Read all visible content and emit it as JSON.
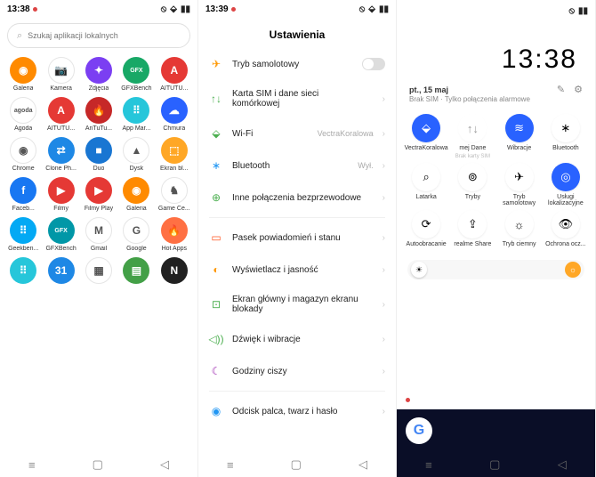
{
  "s1": {
    "time": "13:38",
    "search_placeholder": "Szukaj aplikacji lokalnych",
    "apps": [
      {
        "label": "Galeria",
        "bg": "#ff8a00",
        "txt": "◉"
      },
      {
        "label": "Kamera",
        "bg": "#fff",
        "txt": "📷"
      },
      {
        "label": "Zdjęcia",
        "bg": "#7b3ff2",
        "txt": "✦"
      },
      {
        "label": "GFXBench",
        "bg": "#18a866",
        "txt": "GFX"
      },
      {
        "label": "AITUTU...",
        "bg": "#e53935",
        "txt": "A"
      },
      {
        "label": "Agoda",
        "bg": "#fff",
        "txt": "agoda"
      },
      {
        "label": "AITUTU...",
        "bg": "#e53935",
        "txt": "A"
      },
      {
        "label": "AnTuTu...",
        "bg": "#c62828",
        "txt": "🔥"
      },
      {
        "label": "App Mar...",
        "bg": "#26c6da",
        "txt": "⠿"
      },
      {
        "label": "Chmura",
        "bg": "#2962ff",
        "txt": "☁"
      },
      {
        "label": "Chrome",
        "bg": "#fff",
        "txt": "◉"
      },
      {
        "label": "Clone Ph...",
        "bg": "#1e88e5",
        "txt": "⇄"
      },
      {
        "label": "Duo",
        "bg": "#1976d2",
        "txt": "■"
      },
      {
        "label": "Dysk",
        "bg": "#fff",
        "txt": "▲"
      },
      {
        "label": "Ekran bl...",
        "bg": "#ffa726",
        "txt": "⬚"
      },
      {
        "label": "Faceb...",
        "bg": "#1877f2",
        "txt": "f"
      },
      {
        "label": "Filmy",
        "bg": "#e53935",
        "txt": "▶"
      },
      {
        "label": "Filmy Play",
        "bg": "#e53935",
        "txt": "▶"
      },
      {
        "label": "Galeria",
        "bg": "#ff8a00",
        "txt": "◉"
      },
      {
        "label": "Game Ce...",
        "bg": "#fff",
        "txt": "♞"
      },
      {
        "label": "Geekben...",
        "bg": "#03a9f4",
        "txt": "⠿"
      },
      {
        "label": "GFXBench",
        "bg": "#0097a7",
        "txt": "GFX"
      },
      {
        "label": "Gmail",
        "bg": "#fff",
        "txt": "M"
      },
      {
        "label": "Google",
        "bg": "#fff",
        "txt": "G"
      },
      {
        "label": "Hot Apps",
        "bg": "#ff7043",
        "txt": "🔥"
      },
      {
        "label": "",
        "bg": "#26c6da",
        "txt": "⠿"
      },
      {
        "label": "",
        "bg": "#1e88e5",
        "txt": "31"
      },
      {
        "label": "",
        "bg": "#fff",
        "txt": "▦"
      },
      {
        "label": "",
        "bg": "#43a047",
        "txt": "▤"
      },
      {
        "label": "",
        "bg": "#212121",
        "txt": "N"
      }
    ]
  },
  "s2": {
    "time": "13:39",
    "title": "Ustawienia",
    "items": [
      {
        "icon": "✈",
        "color": "#ff9800",
        "label": "Tryb samolotowy",
        "right": "toggle"
      },
      {
        "icon": "↑↓",
        "color": "#4caf50",
        "label": "Karta SIM i dane sieci komórkowej",
        "right": ""
      },
      {
        "icon": "⬙",
        "color": "#4caf50",
        "label": "Wi-Fi",
        "right": "VectraKoralowa"
      },
      {
        "icon": "∗",
        "color": "#2196f3",
        "label": "Bluetooth",
        "right": "Wył."
      },
      {
        "icon": "⊕",
        "color": "#4caf50",
        "label": "Inne połączenia bezprzewodowe",
        "right": ""
      },
      {
        "sep": true
      },
      {
        "icon": "▭",
        "color": "#ff5722",
        "label": "Pasek powiadomień i stanu",
        "right": ""
      },
      {
        "icon": "◐",
        "color": "#ff9800",
        "label": "Wyświetlacz i jasność",
        "right": ""
      },
      {
        "icon": "⊡",
        "color": "#4caf50",
        "label": "Ekran główny i magazyn ekranu blokady",
        "right": ""
      },
      {
        "icon": "◁))",
        "color": "#4caf50",
        "label": "Dźwięk i wibracje",
        "right": ""
      },
      {
        "icon": "☾",
        "color": "#9c27b0",
        "label": "Godziny ciszy",
        "right": ""
      },
      {
        "sep": true
      },
      {
        "icon": "◉",
        "color": "#2196f3",
        "label": "Odcisk palca, twarz i hasło",
        "right": ""
      }
    ]
  },
  "s3": {
    "clock": "13:38",
    "date": "pt., 15 maj",
    "sub": "Brak SIM · Tylko połączenia alarmowe",
    "tiles": [
      {
        "icon": "⬙",
        "on": true,
        "label": "VectraKoralowa",
        "sub": ""
      },
      {
        "icon": "↑↓",
        "on": false,
        "label": "mej   Dane",
        "sub": "Brak karty SIM",
        "dim": true
      },
      {
        "icon": "≋",
        "on": true,
        "label": "Wibracje",
        "sub": ""
      },
      {
        "icon": "∗",
        "on": false,
        "label": "Bluetooth",
        "sub": ""
      },
      {
        "icon": "⌕",
        "on": false,
        "label": "Latarka",
        "sub": ""
      },
      {
        "icon": "⊚",
        "on": false,
        "label": "Tryby",
        "sub": ""
      },
      {
        "icon": "✈",
        "on": false,
        "label": "Tryb samolotowy",
        "sub": ""
      },
      {
        "icon": "◎",
        "on": true,
        "label": "Usługi lokalizacyjne",
        "sub": ""
      },
      {
        "icon": "⟳",
        "on": false,
        "label": "Autoobracanie",
        "sub": ""
      },
      {
        "icon": "⇪",
        "on": false,
        "label": "realme Share",
        "sub": ""
      },
      {
        "icon": "☼",
        "on": false,
        "label": "Tryb ciemny",
        "sub": ""
      },
      {
        "icon": "👁",
        "on": false,
        "label": "Ochrona ocz...",
        "sub": ""
      }
    ]
  }
}
